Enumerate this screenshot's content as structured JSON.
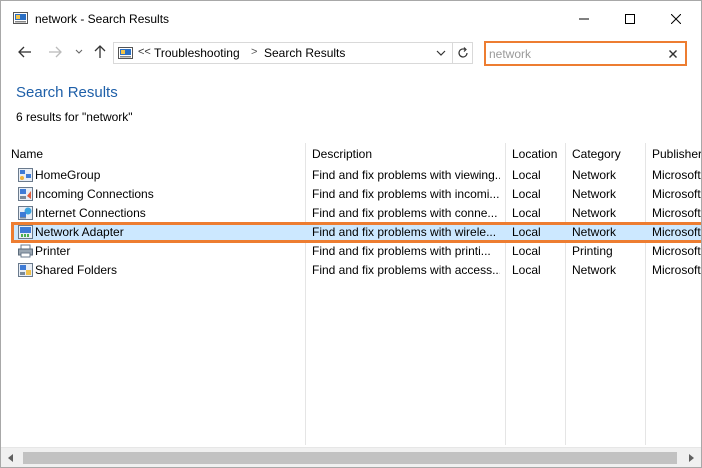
{
  "window": {
    "title": "network - Search Results"
  },
  "address": {
    "chevron": "<<",
    "crumbs": [
      "Troubleshooting",
      "Search Results"
    ],
    "separator": ">"
  },
  "search": {
    "value": "network",
    "placeholder": "network"
  },
  "header": {
    "title": "Search Results",
    "count": "6 results for \"network\""
  },
  "columns": [
    "Name",
    "Description",
    "Location",
    "Category",
    "Publisher"
  ],
  "rows": [
    {
      "name": "HomeGroup",
      "description": "Find and fix problems with viewing...",
      "location": "Local",
      "category": "Network",
      "publisher": "Microsoft",
      "icon": "homegroup-icon"
    },
    {
      "name": "Incoming Connections",
      "description": "Find and fix problems with incomi...",
      "location": "Local",
      "category": "Network",
      "publisher": "Microsoft",
      "icon": "incoming-connections-icon"
    },
    {
      "name": "Internet Connections",
      "description": "Find and fix problems with conne...",
      "location": "Local",
      "category": "Network",
      "publisher": "Microsoft",
      "icon": "internet-connections-icon"
    },
    {
      "name": "Network Adapter",
      "description": "Find and fix problems with wirele...",
      "location": "Local",
      "category": "Network",
      "publisher": "Microsoft",
      "icon": "network-adapter-icon"
    },
    {
      "name": "Printer",
      "description": "Find and fix problems with printi...",
      "location": "Local",
      "category": "Printing",
      "publisher": "Microsoft",
      "icon": "printer-icon"
    },
    {
      "name": "Shared Folders",
      "description": "Find and fix problems with access...",
      "location": "Local",
      "category": "Network",
      "publisher": "Microsoft",
      "icon": "shared-folders-icon"
    }
  ],
  "selected_row": "Network Adapter",
  "colors": {
    "accent_highlight": "#ed7d31",
    "title_blue": "#1e5fa8",
    "selected_bg": "#cce8ff"
  }
}
